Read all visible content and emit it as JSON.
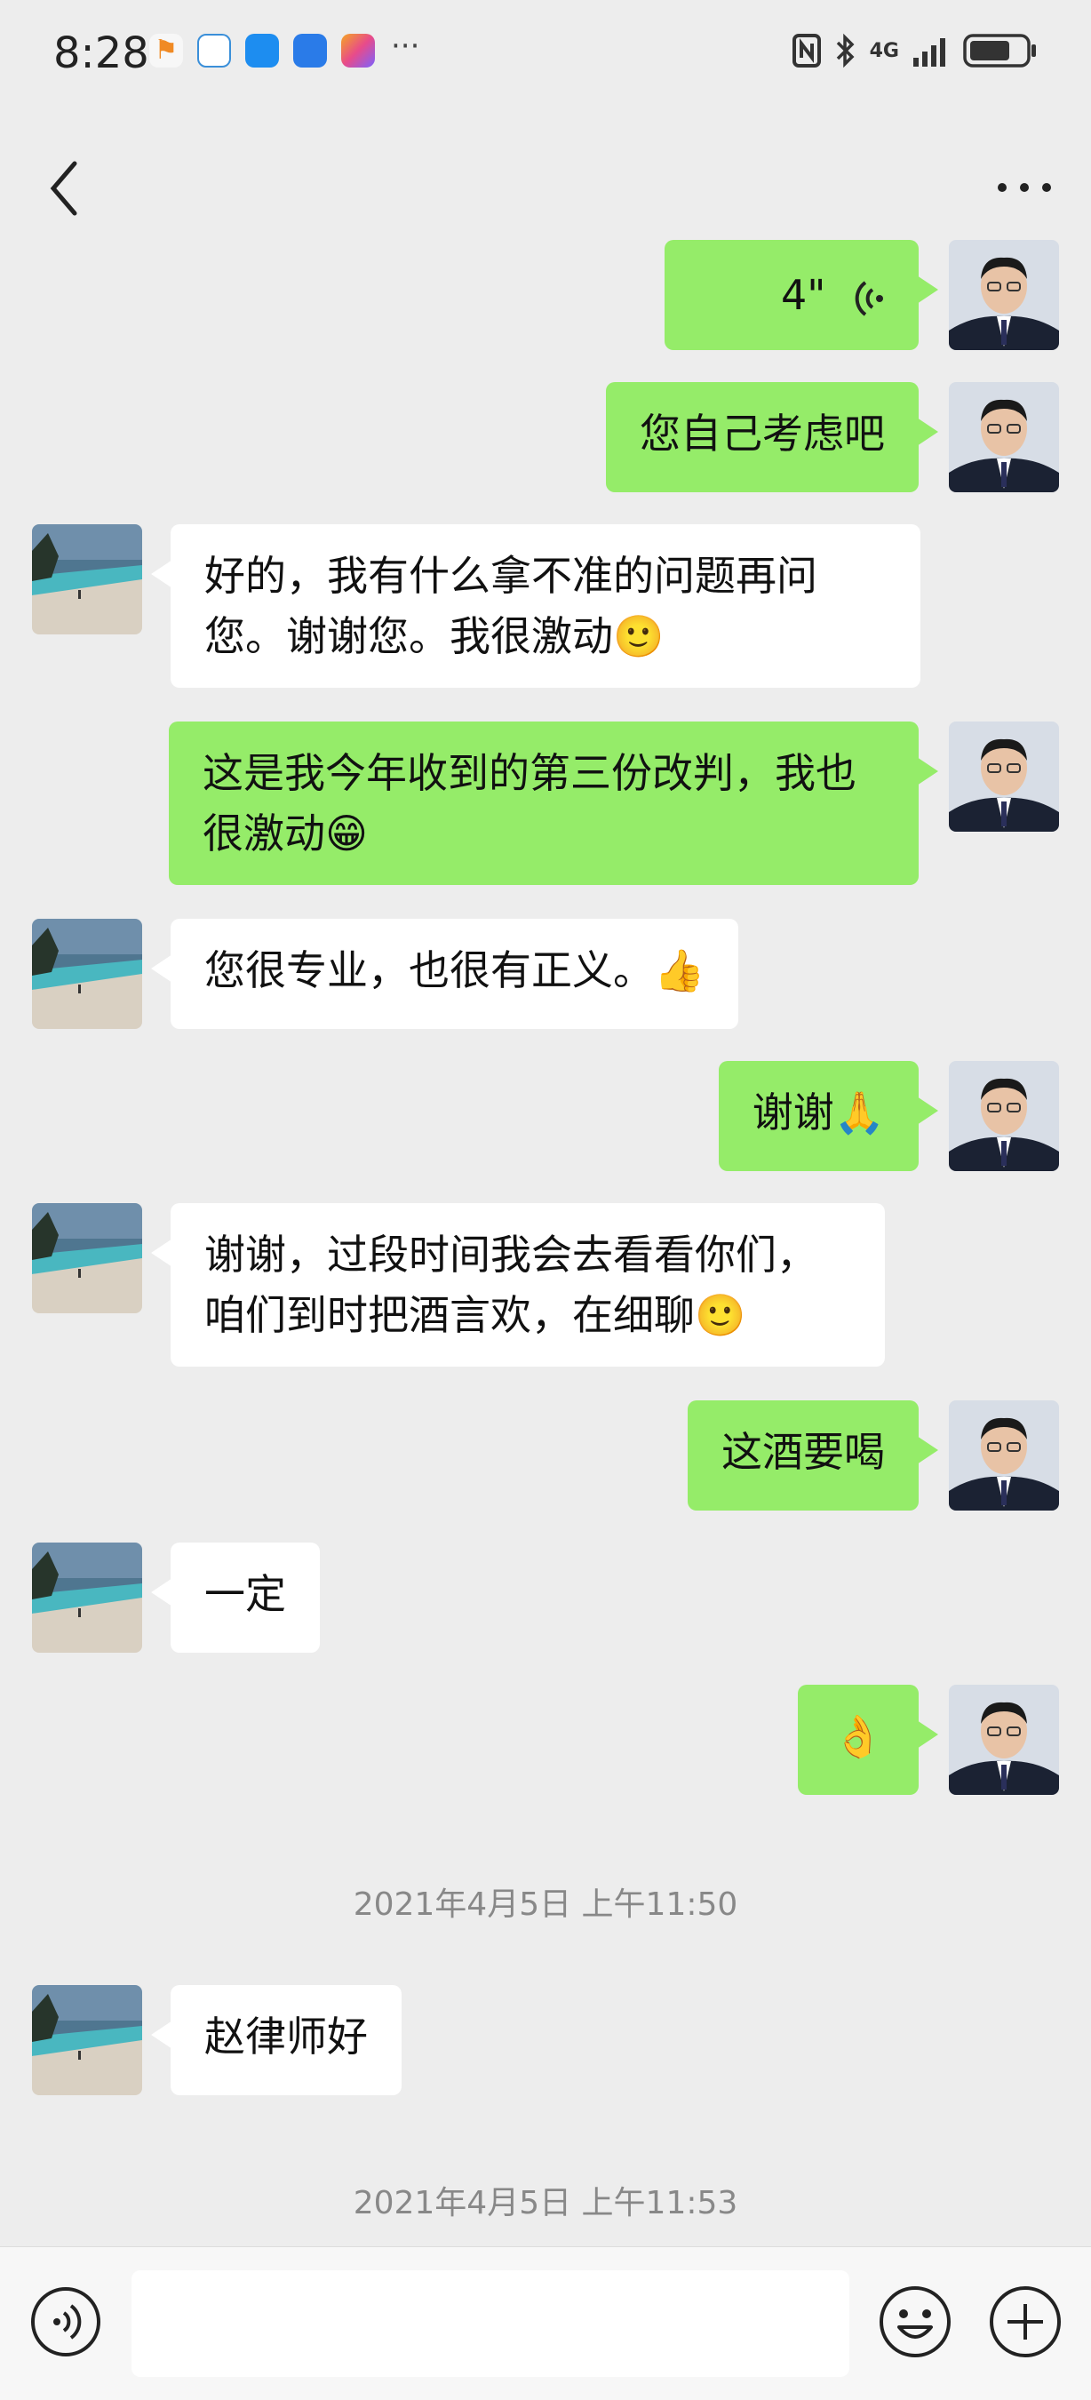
{
  "status_bar": {
    "time": "8:28",
    "network": "4G",
    "app_icons": [
      "app-icon-1",
      "app-icon-2",
      "app-icon-3",
      "app-icon-4",
      "app-icon-5"
    ],
    "more": "···"
  },
  "header": {
    "title": "",
    "back_icon": "chevron-left-icon",
    "more_icon": "more-dots-icon"
  },
  "messages": [
    {
      "side": "out",
      "type": "voice",
      "text": "4\""
    },
    {
      "side": "out",
      "type": "text",
      "text": "您自己考虑吧"
    },
    {
      "side": "in",
      "type": "text",
      "text": "好的，我有什么拿不准的问题再问您。谢谢您。我很激动🙂"
    },
    {
      "side": "out",
      "type": "text",
      "text": "这是我今年收到的第三份改判，我也很激动😁"
    },
    {
      "side": "in",
      "type": "text",
      "text": "您很专业，也很有正义。👍"
    },
    {
      "side": "out",
      "type": "text",
      "text": "谢谢🙏"
    },
    {
      "side": "in",
      "type": "text",
      "text": "谢谢，过段时间我会去看看你们，咱们到时把酒言欢，在细聊🙂"
    },
    {
      "side": "out",
      "type": "text",
      "text": "这酒要喝"
    },
    {
      "side": "in",
      "type": "text",
      "text": "一定"
    },
    {
      "side": "out",
      "type": "text",
      "text": "👌"
    },
    {
      "type": "timestamp",
      "text": "2021年4月5日 上午11:50"
    },
    {
      "side": "in",
      "type": "text",
      "text": "赵律师好"
    },
    {
      "type": "timestamp",
      "text": "2021年4月5日 上午11:53"
    }
  ],
  "input_bar": {
    "voice_icon": "voice-mode-icon",
    "input_value": "",
    "emoji_icon": "emoji-icon",
    "plus_icon": "plus-icon"
  },
  "colors": {
    "background": "#ededed",
    "bubble_out": "#95ec69",
    "bubble_in": "#ffffff"
  }
}
